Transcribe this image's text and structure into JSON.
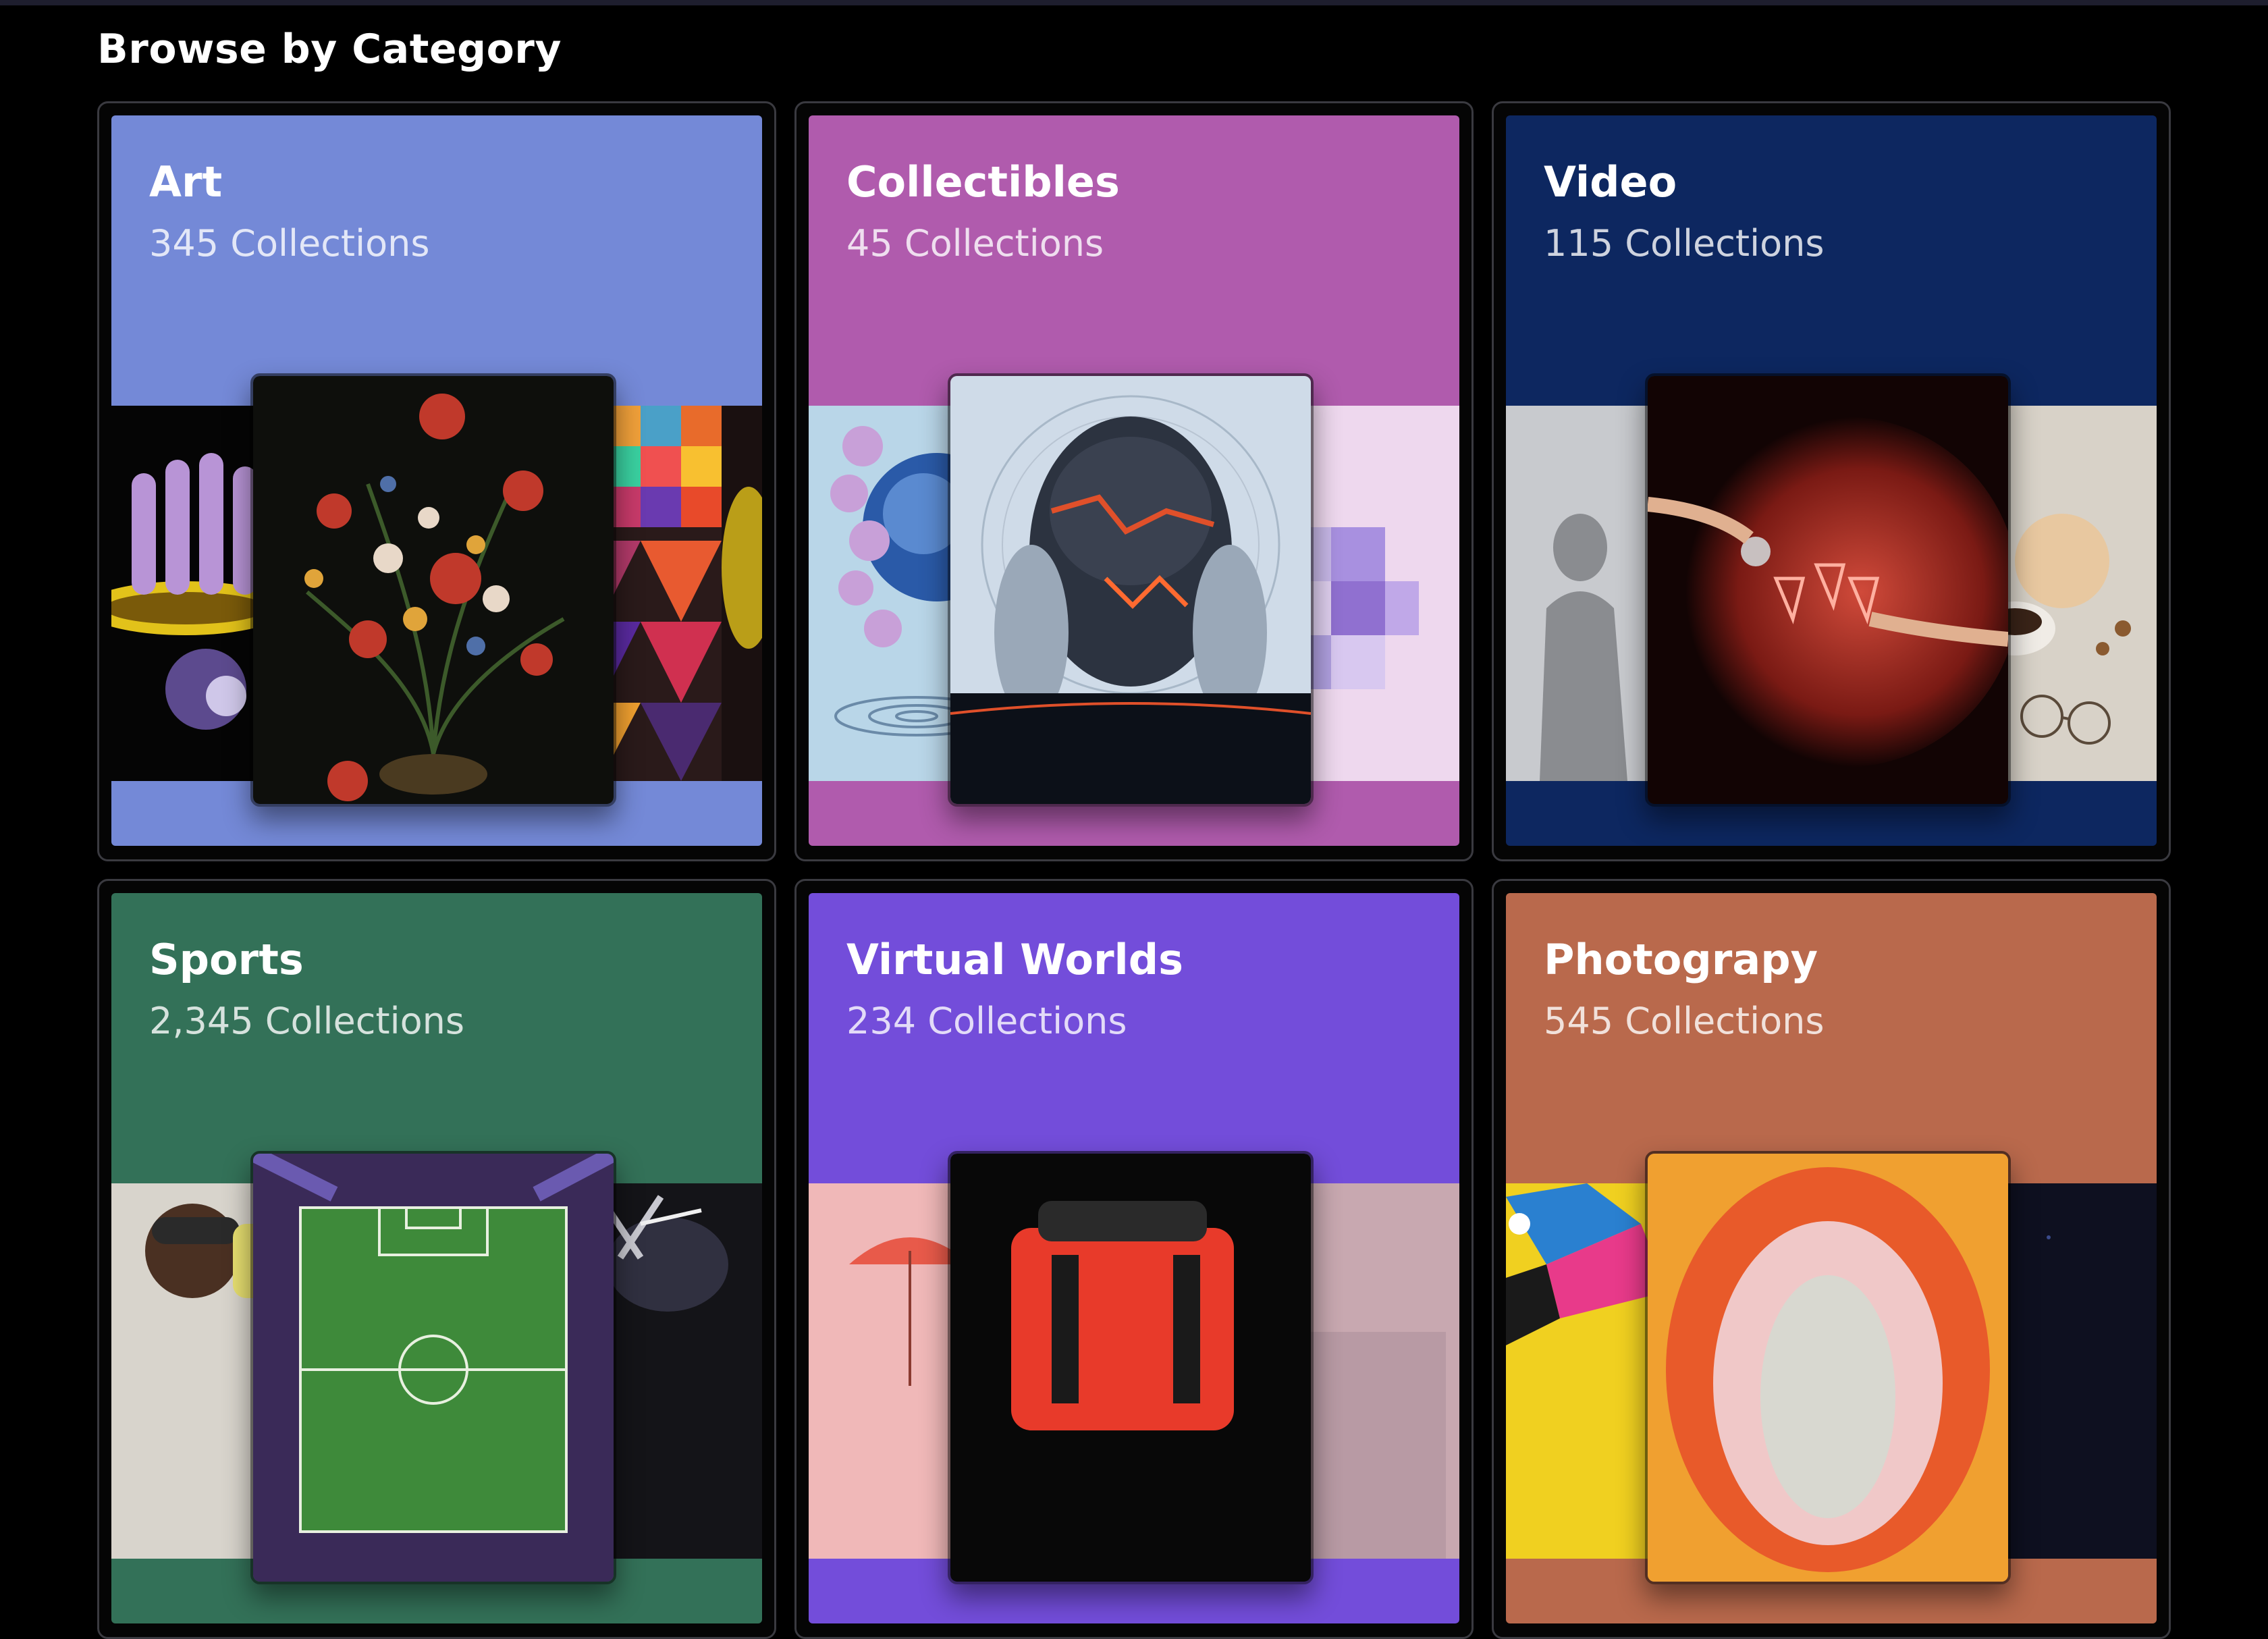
{
  "section": {
    "title": "Browse by Category"
  },
  "categories": [
    {
      "title": "Art",
      "count": "345 Collections",
      "color": "#7489d7"
    },
    {
      "title": "Collectibles",
      "count": "45 Collections",
      "color": "#b05bad"
    },
    {
      "title": "Video",
      "count": "115 Collections",
      "color": "#0d2760"
    },
    {
      "title": "Sports",
      "count": "2,345 Collections",
      "color": "#337158"
    },
    {
      "title": "Virtual Worlds",
      "count": "234 Collections",
      "color": "#734dda"
    },
    {
      "title": "Photograpy",
      "count": "545 Collections",
      "color": "#b9694c"
    }
  ]
}
